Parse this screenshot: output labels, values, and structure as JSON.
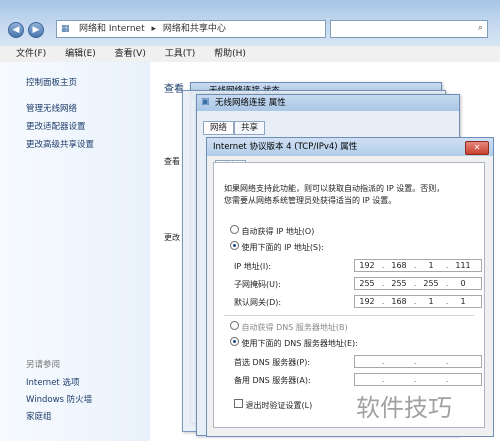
{
  "explorer": {
    "breadcrumb": [
      "网络和 Internet",
      "网络和共享中心"
    ],
    "menu": [
      "文件(F)",
      "编辑(E)",
      "查看(V)",
      "工具(T)",
      "帮助(H)"
    ],
    "sidebar_top": [
      "控制面板主页"
    ],
    "sidebar_links": [
      "管理无线网络",
      "更改适配器设置",
      "更改高级共享设置"
    ],
    "see_also": "另请参阅",
    "see_also_links": [
      "Internet 选项",
      "Windows 防火墙",
      "家庭组"
    ],
    "main_fragments": [
      "查看",
      "查看",
      "更改"
    ]
  },
  "status_dialog": {
    "title": "无线网络连接 状态"
  },
  "props_dialog": {
    "title": "无线网络连接 属性",
    "tabs": [
      "网络",
      "共享"
    ]
  },
  "ipv4": {
    "title": "Internet 协议版本 4 (TCP/IPv4) 属性",
    "tab": "常规",
    "desc1": "如果网络支持此功能，则可以获取自动指派的 IP 设置。否则，",
    "desc2": "您需要从网络系统管理员处获得适当的 IP 设置。",
    "auto_ip": "自动获得 IP 地址(O)",
    "manual_ip": "使用下面的 IP 地址(S):",
    "ip_label": "IP 地址(I):",
    "ip": [
      "192",
      "168",
      "1",
      "111"
    ],
    "mask_label": "子网掩码(U):",
    "mask": [
      "255",
      "255",
      "255",
      "0"
    ],
    "gw_label": "默认网关(D):",
    "gw": [
      "192",
      "168",
      "1",
      "1"
    ],
    "auto_dns": "自动获得 DNS 服务器地址(B)",
    "manual_dns": "使用下面的 DNS 服务器地址(E):",
    "dns1_label": "首选 DNS 服务器(P):",
    "dns2_label": "备用 DNS 服务器(A):",
    "validate": "退出时验证设置(L)"
  },
  "watermark": "软件技巧"
}
